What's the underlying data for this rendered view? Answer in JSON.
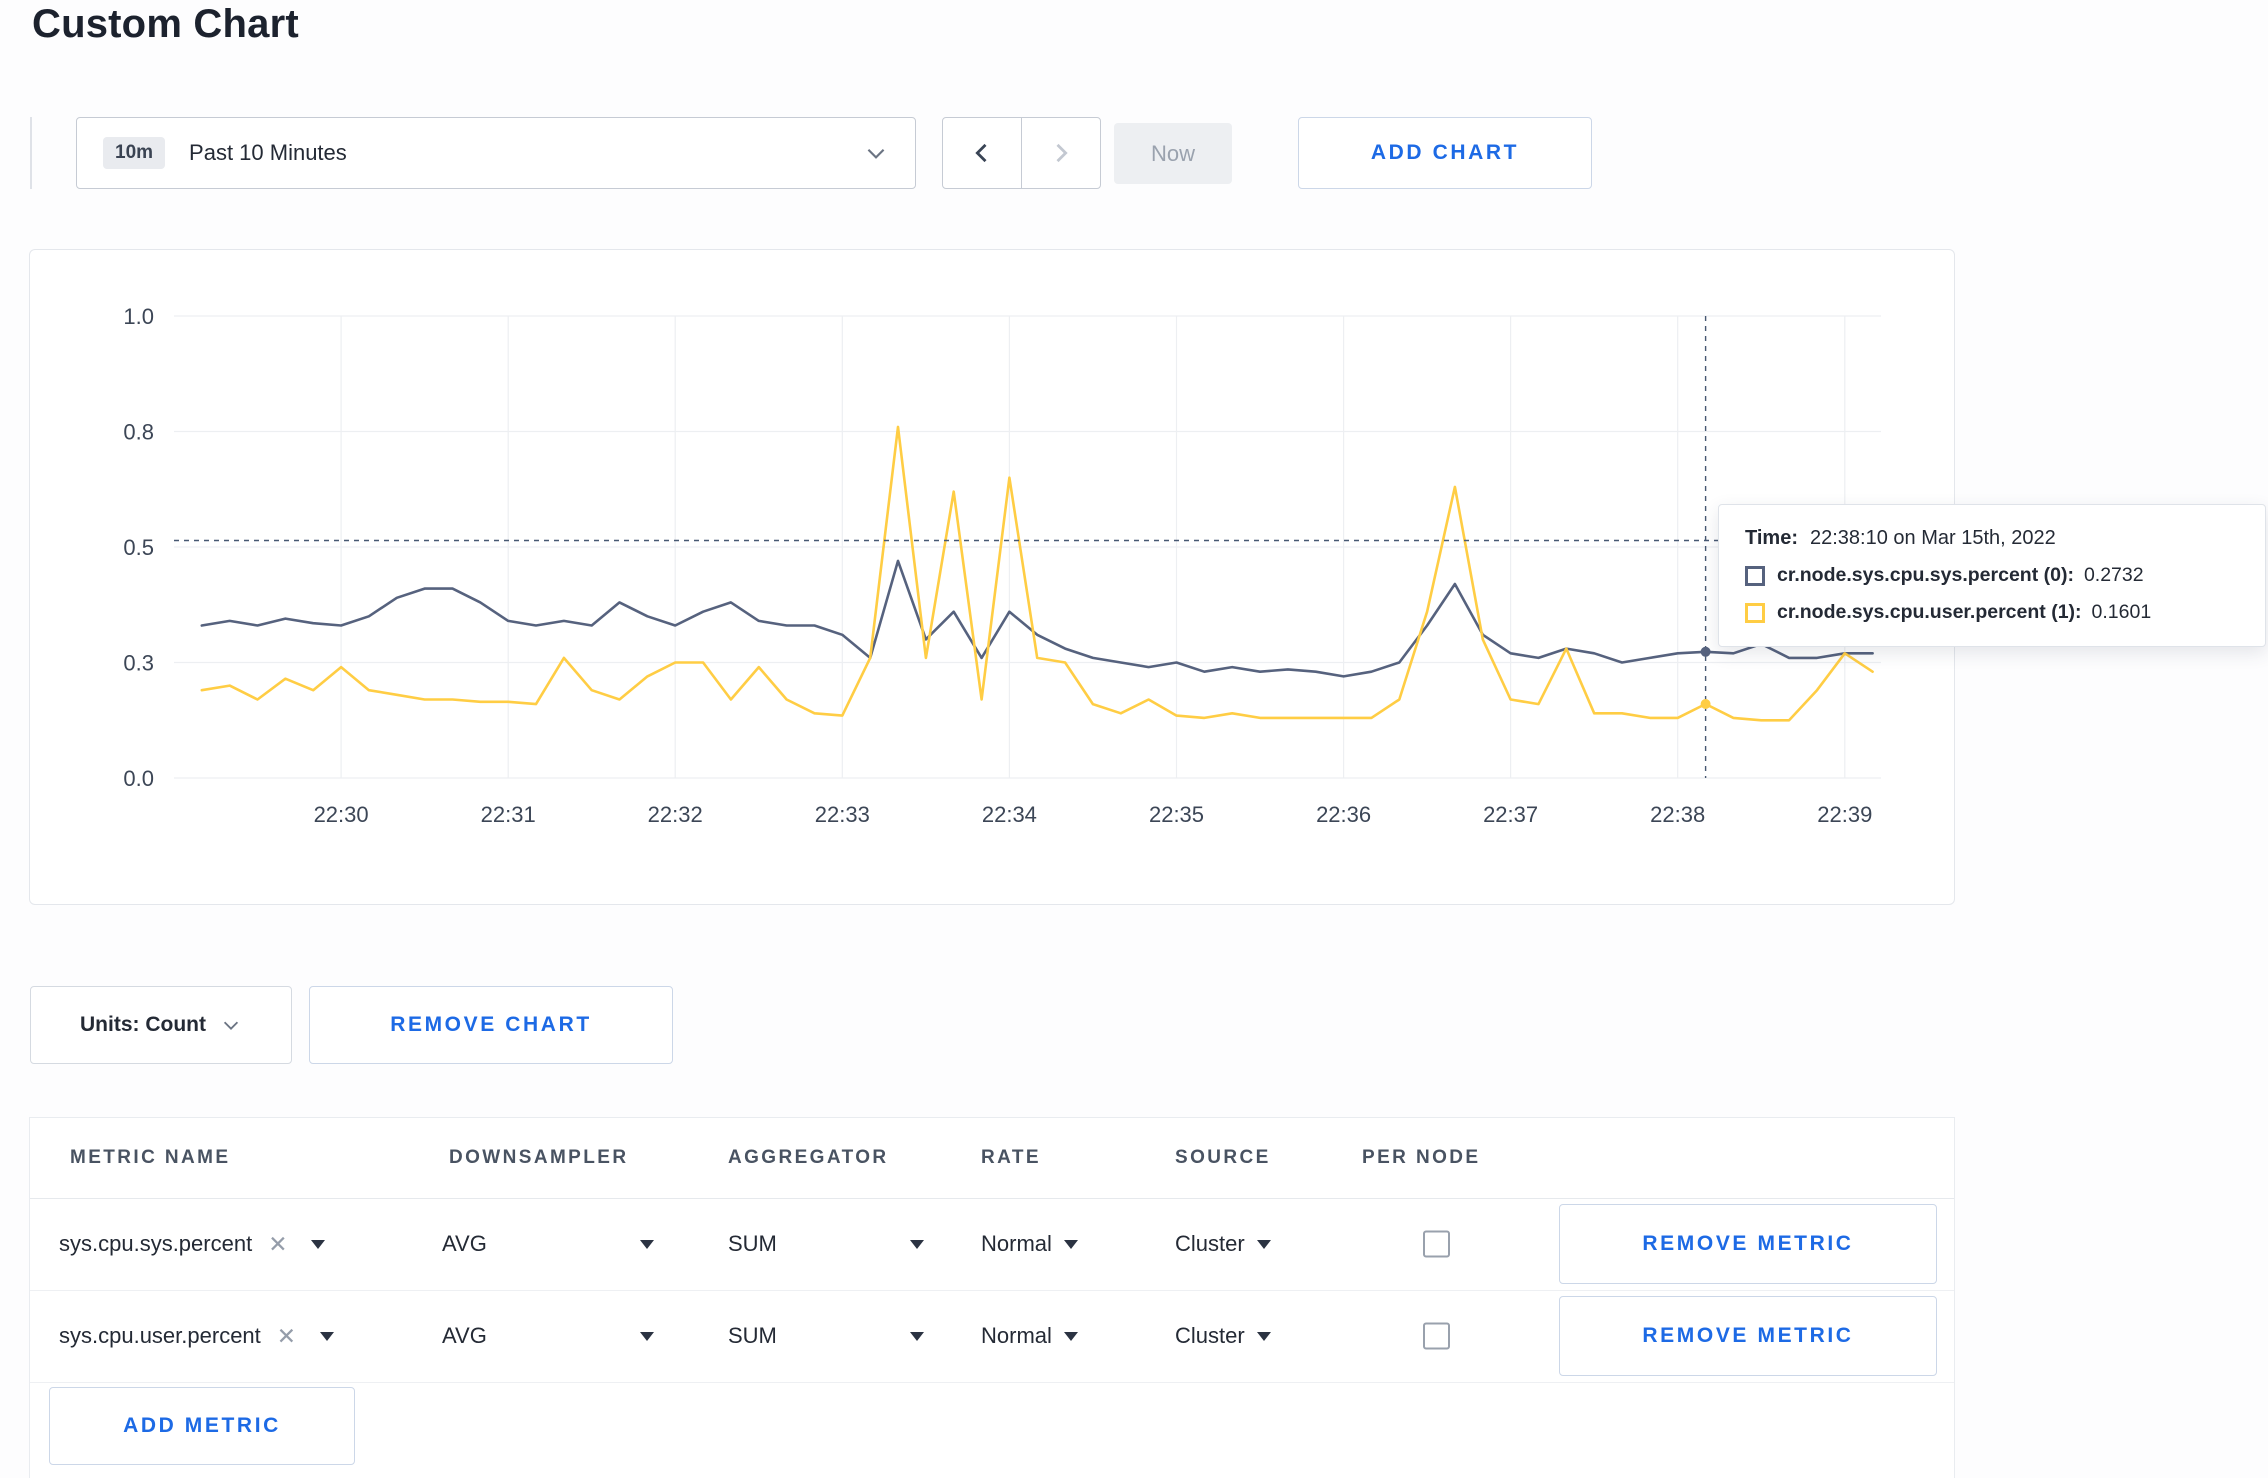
{
  "page": {
    "title": "Custom Chart"
  },
  "colors": {
    "accent_blue": "#1d6ae5",
    "series_sys": "#56627e",
    "series_user": "#ffcd44"
  },
  "toolbar": {
    "time_window_badge": "10m",
    "time_window_label": "Past 10 Minutes",
    "now_label": "Now",
    "add_chart_label": "ADD CHART"
  },
  "chart_data": {
    "type": "line",
    "title": "",
    "xlabel": "",
    "ylabel": "",
    "grid": true,
    "legend_position": "tooltip",
    "ylim": [
      0,
      1
    ],
    "x_domain_seconds": [
      0,
      613
    ],
    "x_ticks": [
      {
        "label": "22:30",
        "seconds": 60
      },
      {
        "label": "22:31",
        "seconds": 120
      },
      {
        "label": "22:32",
        "seconds": 180
      },
      {
        "label": "22:33",
        "seconds": 240
      },
      {
        "label": "22:34",
        "seconds": 300
      },
      {
        "label": "22:35",
        "seconds": 360
      },
      {
        "label": "22:36",
        "seconds": 420
      },
      {
        "label": "22:37",
        "seconds": 480
      },
      {
        "label": "22:38",
        "seconds": 540
      },
      {
        "label": "22:39",
        "seconds": 600
      }
    ],
    "y_ticks": [
      {
        "value": 0,
        "label": "0.0"
      },
      {
        "value": 0.25,
        "label": "0.3"
      },
      {
        "value": 0.5,
        "label": "0.5"
      },
      {
        "value": 0.75,
        "label": "0.8"
      },
      {
        "value": 1,
        "label": "1.0"
      }
    ],
    "series": [
      {
        "name": "cr.node.sys.cpu.sys.percent",
        "color": "#56627e",
        "points": [
          [
            10,
            0.33
          ],
          [
            20,
            0.34
          ],
          [
            30,
            0.33
          ],
          [
            40,
            0.345
          ],
          [
            50,
            0.335
          ],
          [
            60,
            0.33
          ],
          [
            70,
            0.35
          ],
          [
            80,
            0.39
          ],
          [
            90,
            0.41
          ],
          [
            100,
            0.41
          ],
          [
            110,
            0.38
          ],
          [
            120,
            0.34
          ],
          [
            130,
            0.33
          ],
          [
            140,
            0.34
          ],
          [
            150,
            0.33
          ],
          [
            160,
            0.38
          ],
          [
            170,
            0.35
          ],
          [
            180,
            0.33
          ],
          [
            190,
            0.36
          ],
          [
            200,
            0.38
          ],
          [
            210,
            0.34
          ],
          [
            220,
            0.33
          ],
          [
            230,
            0.33
          ],
          [
            240,
            0.31
          ],
          [
            250,
            0.26
          ],
          [
            260,
            0.47
          ],
          [
            270,
            0.3
          ],
          [
            280,
            0.36
          ],
          [
            290,
            0.26
          ],
          [
            300,
            0.36
          ],
          [
            310,
            0.31
          ],
          [
            320,
            0.28
          ],
          [
            330,
            0.26
          ],
          [
            340,
            0.25
          ],
          [
            350,
            0.24
          ],
          [
            360,
            0.25
          ],
          [
            370,
            0.23
          ],
          [
            380,
            0.24
          ],
          [
            390,
            0.23
          ],
          [
            400,
            0.235
          ],
          [
            410,
            0.23
          ],
          [
            420,
            0.22
          ],
          [
            430,
            0.23
          ],
          [
            440,
            0.25
          ],
          [
            450,
            0.33
          ],
          [
            460,
            0.42
          ],
          [
            470,
            0.31
          ],
          [
            480,
            0.27
          ],
          [
            490,
            0.26
          ],
          [
            500,
            0.28
          ],
          [
            510,
            0.27
          ],
          [
            520,
            0.25
          ],
          [
            530,
            0.26
          ],
          [
            540,
            0.27
          ],
          [
            550,
            0.2732
          ],
          [
            560,
            0.27
          ],
          [
            570,
            0.29
          ],
          [
            580,
            0.26
          ],
          [
            590,
            0.26
          ],
          [
            600,
            0.27
          ],
          [
            610,
            0.27
          ]
        ]
      },
      {
        "name": "cr.node.sys.cpu.user.percent",
        "color": "#ffcd44",
        "points": [
          [
            10,
            0.19
          ],
          [
            20,
            0.2
          ],
          [
            30,
            0.17
          ],
          [
            40,
            0.215
          ],
          [
            50,
            0.19
          ],
          [
            60,
            0.24
          ],
          [
            70,
            0.19
          ],
          [
            80,
            0.18
          ],
          [
            90,
            0.17
          ],
          [
            100,
            0.17
          ],
          [
            110,
            0.165
          ],
          [
            120,
            0.165
          ],
          [
            130,
            0.16
          ],
          [
            140,
            0.26
          ],
          [
            150,
            0.19
          ],
          [
            160,
            0.17
          ],
          [
            170,
            0.22
          ],
          [
            180,
            0.25
          ],
          [
            190,
            0.25
          ],
          [
            200,
            0.17
          ],
          [
            210,
            0.24
          ],
          [
            220,
            0.17
          ],
          [
            230,
            0.14
          ],
          [
            240,
            0.135
          ],
          [
            250,
            0.26
          ],
          [
            260,
            0.76
          ],
          [
            270,
            0.26
          ],
          [
            280,
            0.62
          ],
          [
            290,
            0.17
          ],
          [
            300,
            0.65
          ],
          [
            310,
            0.26
          ],
          [
            320,
            0.25
          ],
          [
            330,
            0.16
          ],
          [
            340,
            0.14
          ],
          [
            350,
            0.17
          ],
          [
            360,
            0.135
          ],
          [
            370,
            0.13
          ],
          [
            380,
            0.14
          ],
          [
            390,
            0.13
          ],
          [
            400,
            0.13
          ],
          [
            410,
            0.13
          ],
          [
            420,
            0.13
          ],
          [
            430,
            0.13
          ],
          [
            440,
            0.17
          ],
          [
            450,
            0.36
          ],
          [
            460,
            0.63
          ],
          [
            470,
            0.3
          ],
          [
            480,
            0.17
          ],
          [
            490,
            0.16
          ],
          [
            500,
            0.28
          ],
          [
            510,
            0.14
          ],
          [
            520,
            0.14
          ],
          [
            530,
            0.13
          ],
          [
            540,
            0.13
          ],
          [
            550,
            0.1601
          ],
          [
            560,
            0.13
          ],
          [
            570,
            0.125
          ],
          [
            580,
            0.125
          ],
          [
            590,
            0.19
          ],
          [
            600,
            0.27
          ],
          [
            610,
            0.23
          ]
        ]
      }
    ],
    "crosshair": {
      "x_seconds": 550,
      "y_value": 0.514,
      "markers": [
        {
          "series": 0,
          "value": 0.2732
        },
        {
          "series": 1,
          "value": 0.1601
        }
      ]
    }
  },
  "tooltip": {
    "time_label": "Time:",
    "time_value": "22:38:10 on Mar 15th, 2022",
    "rows": [
      {
        "name": "cr.node.sys.cpu.sys.percent (0):",
        "value": "0.2732"
      },
      {
        "name": "cr.node.sys.cpu.user.percent (1):",
        "value": "0.1601"
      }
    ]
  },
  "chart_controls": {
    "units_label": "Units: Count",
    "remove_chart_label": "REMOVE CHART"
  },
  "metrics_table": {
    "headers": [
      "METRIC NAME",
      "DOWNSAMPLER",
      "AGGREGATOR",
      "RATE",
      "SOURCE",
      "PER NODE"
    ],
    "remove_metric_label": "REMOVE METRIC",
    "add_metric_label": "ADD METRIC",
    "rows": [
      {
        "metric": "sys.cpu.sys.percent",
        "downsampler": "AVG",
        "aggregator": "SUM",
        "rate": "Normal",
        "source": "Cluster",
        "per_node_checked": false
      },
      {
        "metric": "sys.cpu.user.percent",
        "downsampler": "AVG",
        "aggregator": "SUM",
        "rate": "Normal",
        "source": "Cluster",
        "per_node_checked": false
      }
    ]
  }
}
